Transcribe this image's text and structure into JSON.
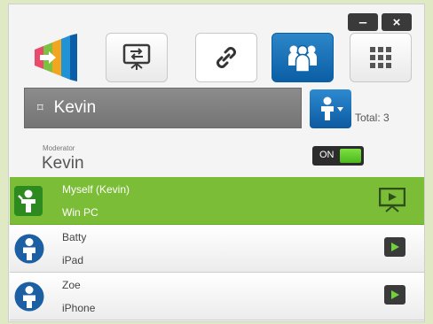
{
  "window": {
    "minimize_label": "‒",
    "close_label": "×"
  },
  "toolbar": {
    "logo": "app-logo",
    "buttons": [
      {
        "name": "screen-share-icon",
        "active": false
      },
      {
        "name": "link-icon",
        "active": false
      },
      {
        "name": "participants-icon",
        "active": true
      },
      {
        "name": "grid-menu-icon",
        "active": false
      }
    ]
  },
  "header": {
    "flag_icon": "⌑",
    "name": "Kevin",
    "total_label": "Total: 3"
  },
  "moderator": {
    "label": "Moderator",
    "name": "Kevin",
    "toggle_label": "ON"
  },
  "participants": [
    {
      "title": "Myself (Kevin)",
      "device": "Win PC",
      "self": true
    },
    {
      "title": "Batty",
      "device": "iPad",
      "self": false
    },
    {
      "title": "Zoe",
      "device": "iPhone",
      "self": false
    }
  ],
  "colors": {
    "accent_blue": "#0b5fa5",
    "self_green": "#7cbd38",
    "toggle_green": "#5cc82a"
  }
}
